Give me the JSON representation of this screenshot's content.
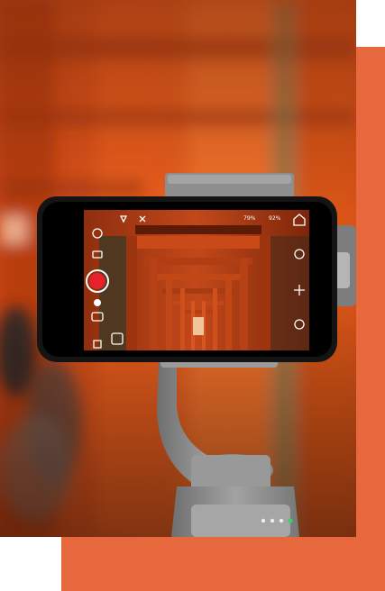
{
  "colors": {
    "accent": "#e8683e",
    "background": "#ffffff",
    "torii_orange": "#e2541c",
    "torii_dark": "#a8300c",
    "gimbal_gray": "#8c8c8c",
    "phone_black": "#141414",
    "record_red": "#e8202c"
  },
  "photo": {
    "subject": "smartphone-on-gimbal-filming-torii-gates"
  },
  "camera_ui": {
    "stat_1": "79%",
    "stat_2": "92%",
    "icons": [
      "home-icon",
      "camera-icon",
      "gimbal-icon",
      "settings-icon",
      "record-button",
      "flash-icon",
      "capture-mode-icon"
    ]
  }
}
